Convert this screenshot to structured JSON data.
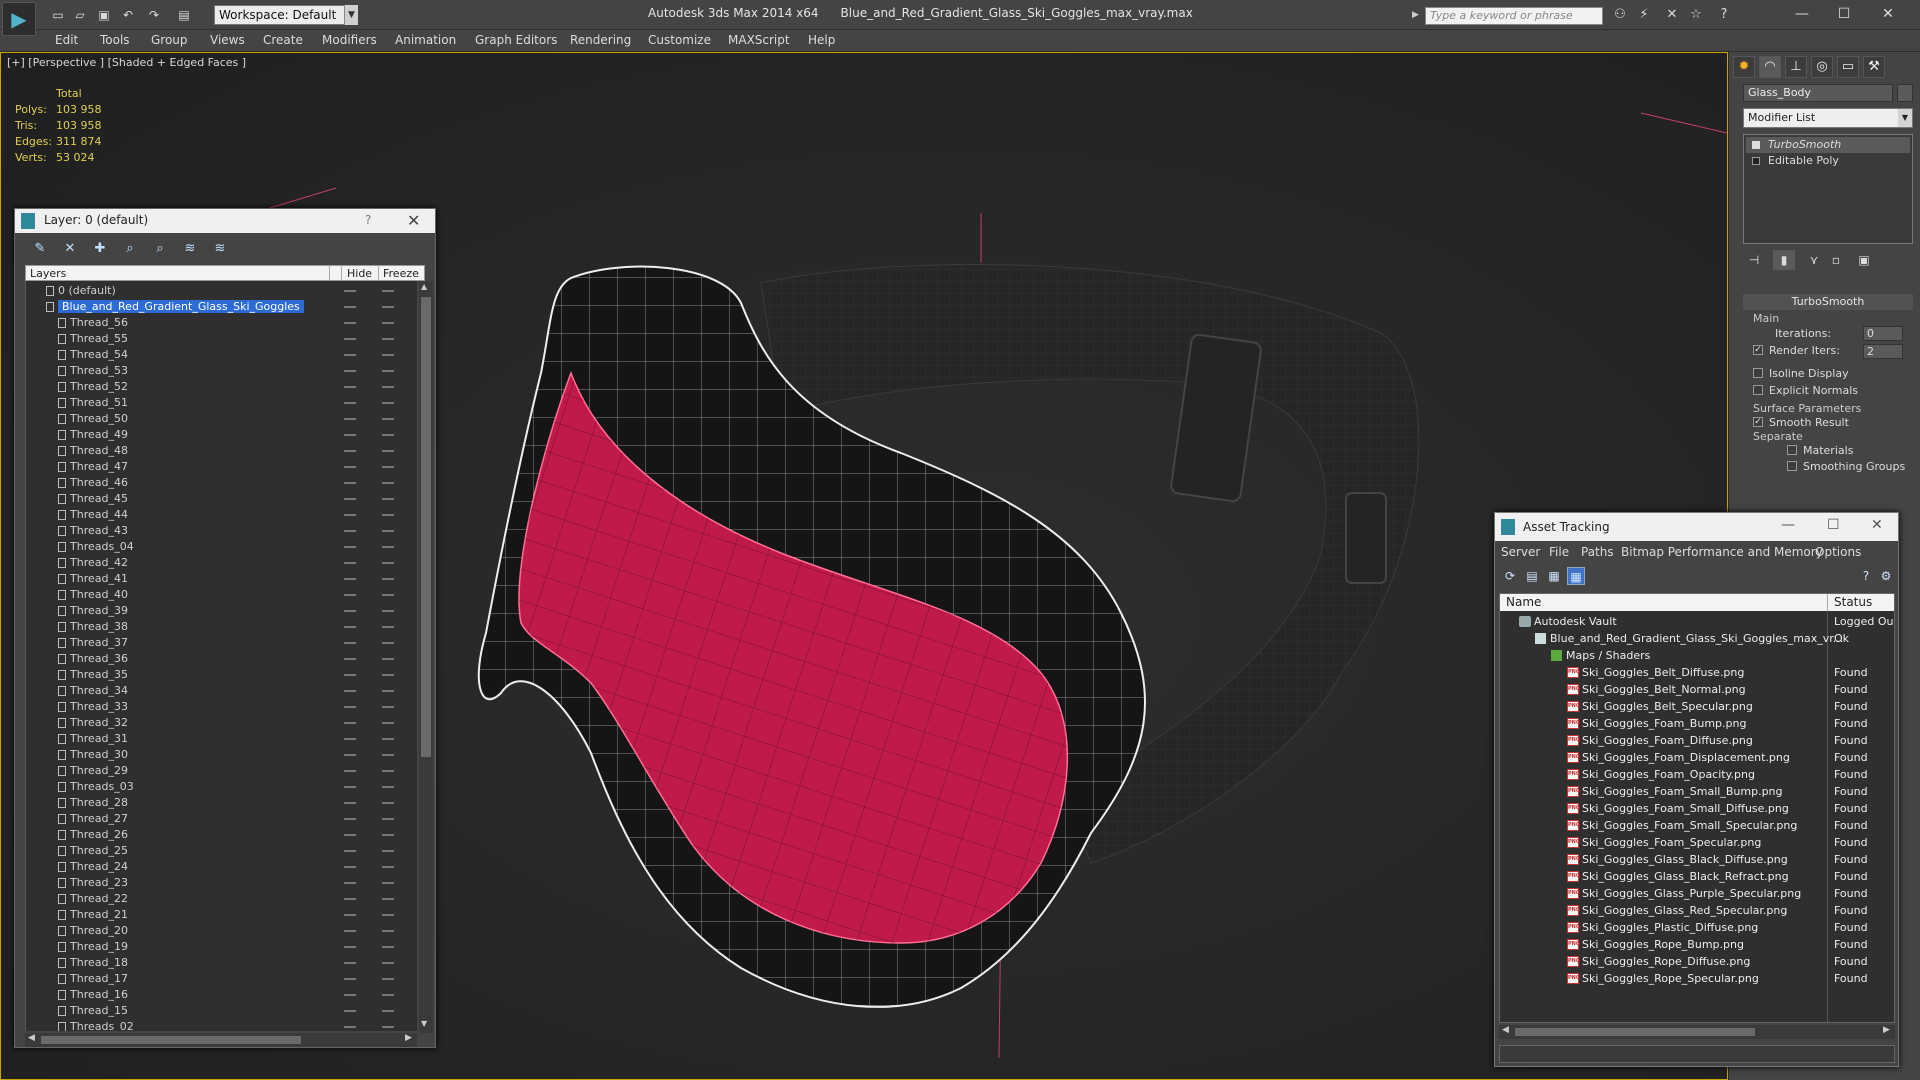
{
  "titlebar": {
    "workspace": "Workspace: Default",
    "app": "Autodesk 3ds Max  2014 x64",
    "file": "Blue_and_Red_Gradient_Glass_Ski_Goggles_max_vray.max",
    "search_placeholder": "Type a keyword or phrase"
  },
  "menu": [
    "Edit",
    "Tools",
    "Group",
    "Views",
    "Create",
    "Modifiers",
    "Animation",
    "Graph Editors",
    "Rendering",
    "Customize",
    "MAXScript",
    "Help"
  ],
  "viewport": {
    "label": "[+] [Perspective ] [Shaded + Edged Faces ]",
    "stats": {
      "header": "Total",
      "rows": [
        {
          "label": "Polys:",
          "value": "103 958"
        },
        {
          "label": "Tris:",
          "value": "103 958"
        },
        {
          "label": "Edges:",
          "value": "311 874"
        },
        {
          "label": "Verts:",
          "value": "53 024"
        }
      ]
    }
  },
  "layer_dialog": {
    "title": "Layer: 0 (default)",
    "help": "?",
    "columns": {
      "layers": "Layers",
      "hide": "Hide",
      "freeze": "Freeze"
    },
    "default_layer": "0 (default)",
    "selected_layer": "Blue_and_Red_Gradient_Glass_Ski_Goggles",
    "children": [
      "Thread_56",
      "Thread_55",
      "Thread_54",
      "Thread_53",
      "Thread_52",
      "Thread_51",
      "Thread_50",
      "Thread_49",
      "Thread_48",
      "Thread_47",
      "Thread_46",
      "Thread_45",
      "Thread_44",
      "Thread_43",
      "Threads_04",
      "Thread_42",
      "Thread_41",
      "Thread_40",
      "Thread_39",
      "Thread_38",
      "Thread_37",
      "Thread_36",
      "Thread_35",
      "Thread_34",
      "Thread_33",
      "Thread_32",
      "Thread_31",
      "Thread_30",
      "Thread_29",
      "Threads_03",
      "Thread_28",
      "Thread_27",
      "Thread_26",
      "Thread_25",
      "Thread_24",
      "Thread_23",
      "Thread_22",
      "Thread_21",
      "Thread_20",
      "Thread_19",
      "Thread_18",
      "Thread_17",
      "Thread_16",
      "Thread_15",
      "Threads_02"
    ]
  },
  "command_panel": {
    "object_name": "Glass_Body",
    "modifier_list": "Modifier List",
    "stack": [
      "TurboSmooth",
      "Editable Poly"
    ],
    "rollout_title": "TurboSmooth",
    "main_group": "Main",
    "iterations_label": "Iterations:",
    "iterations_value": "0",
    "render_iters_label": "Render Iters:",
    "render_iters_value": "2",
    "isoline": "Isoline Display",
    "explicit_normals": "Explicit Normals",
    "surface_group": "Surface Parameters",
    "smooth_result": "Smooth Result",
    "separate": "Separate",
    "materials": "Materials",
    "smoothing_groups": "Smoothing Groups"
  },
  "asset_dialog": {
    "title": "Asset Tracking",
    "menu": [
      "Server",
      "File",
      "Paths",
      "Bitmap Performance and Memory",
      "Options"
    ],
    "columns": {
      "name": "Name",
      "status": "Status"
    },
    "vault": {
      "name": "Autodesk Vault",
      "status": "Logged Ou"
    },
    "file": {
      "name": "Blue_and_Red_Gradient_Glass_Ski_Goggles_max_vr...",
      "status": "Ok"
    },
    "maps_folder": "Maps / Shaders",
    "maps": [
      {
        "name": "Ski_Goggles_Belt_Diffuse.png",
        "status": "Found"
      },
      {
        "name": "Ski_Goggles_Belt_Normal.png",
        "status": "Found"
      },
      {
        "name": "Ski_Goggles_Belt_Specular.png",
        "status": "Found"
      },
      {
        "name": "Ski_Goggles_Foam_Bump.png",
        "status": "Found"
      },
      {
        "name": "Ski_Goggles_Foam_Diffuse.png",
        "status": "Found"
      },
      {
        "name": "Ski_Goggles_Foam_Displacement.png",
        "status": "Found"
      },
      {
        "name": "Ski_Goggles_Foam_Opacity.png",
        "status": "Found"
      },
      {
        "name": "Ski_Goggles_Foam_Small_Bump.png",
        "status": "Found"
      },
      {
        "name": "Ski_Goggles_Foam_Small_Diffuse.png",
        "status": "Found"
      },
      {
        "name": "Ski_Goggles_Foam_Small_Specular.png",
        "status": "Found"
      },
      {
        "name": "Ski_Goggles_Foam_Specular.png",
        "status": "Found"
      },
      {
        "name": "Ski_Goggles_Glass_Black_Diffuse.png",
        "status": "Found"
      },
      {
        "name": "Ski_Goggles_Glass_Black_Refract.png",
        "status": "Found"
      },
      {
        "name": "Ski_Goggles_Glass_Purple_Specular.png",
        "status": "Found"
      },
      {
        "name": "Ski_Goggles_Glass_Red_Specular.png",
        "status": "Found"
      },
      {
        "name": "Ski_Goggles_Plastic_Diffuse.png",
        "status": "Found"
      },
      {
        "name": "Ski_Goggles_Rope_Bump.png",
        "status": "Found"
      },
      {
        "name": "Ski_Goggles_Rope_Diffuse.png",
        "status": "Found"
      },
      {
        "name": "Ski_Goggles_Rope_Specular.png",
        "status": "Found"
      }
    ]
  },
  "colors": {
    "accent": "#2c6bd4",
    "viewport_border": "#c8a400",
    "stats": "#e0d050",
    "lens": "#c01a4a"
  }
}
